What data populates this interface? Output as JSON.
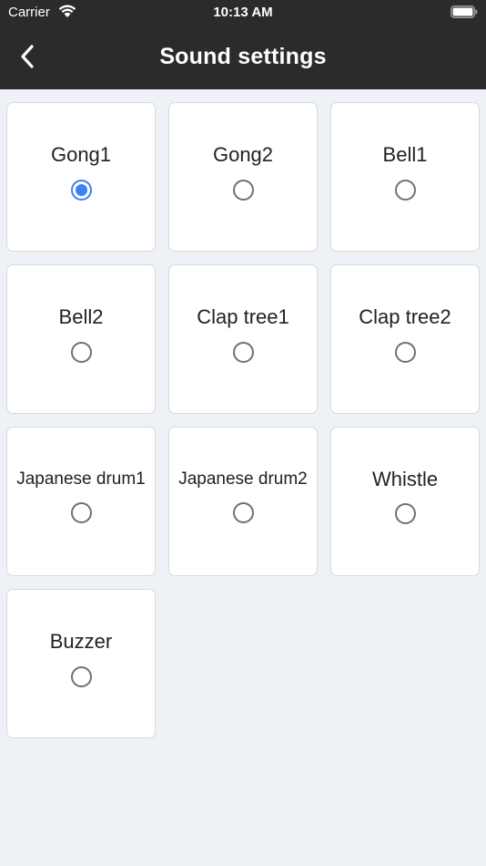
{
  "status_bar": {
    "carrier": "Carrier",
    "time": "10:13 AM"
  },
  "header": {
    "title": "Sound settings"
  },
  "colors": {
    "header_bg": "#2b2b2b",
    "page_bg": "#eef2f7",
    "accent": "#3d82f0"
  },
  "sounds": [
    {
      "label": "Gong1",
      "selected": true
    },
    {
      "label": "Gong2",
      "selected": false
    },
    {
      "label": "Bell1",
      "selected": false
    },
    {
      "label": "Bell2",
      "selected": false
    },
    {
      "label": "Clap tree1",
      "selected": false
    },
    {
      "label": "Clap tree2",
      "selected": false
    },
    {
      "label": "Japanese drum1",
      "selected": false
    },
    {
      "label": "Japanese drum2",
      "selected": false
    },
    {
      "label": "Whistle",
      "selected": false
    },
    {
      "label": "Buzzer",
      "selected": false
    }
  ]
}
